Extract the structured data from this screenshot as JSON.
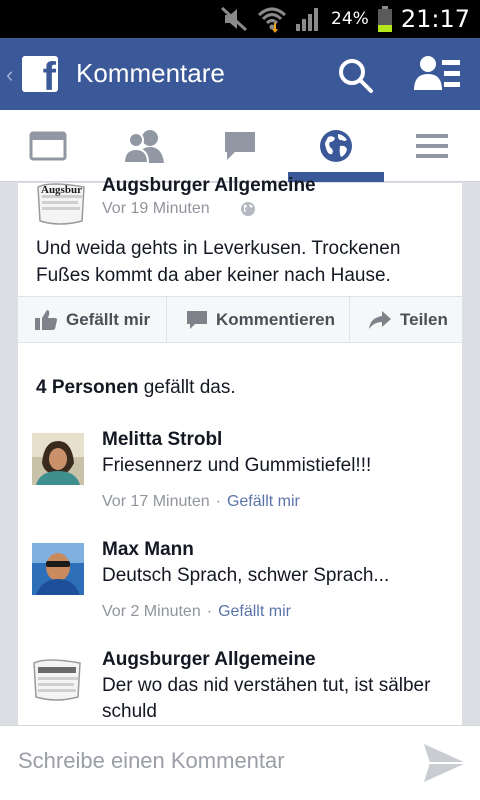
{
  "status_bar": {
    "battery_percent": "24%",
    "time": "21:17"
  },
  "app_bar": {
    "title": "Kommentare",
    "logo_letter": "f",
    "back": "‹"
  },
  "tabs": [
    {
      "id": "news-feed",
      "active": false
    },
    {
      "id": "friend-requests",
      "active": false
    },
    {
      "id": "messages",
      "active": false
    },
    {
      "id": "notifications",
      "active": true
    },
    {
      "id": "more",
      "active": false
    }
  ],
  "post": {
    "author": "Augsburger Allgemeine",
    "time": "Vor 19 Minuten",
    "text": "Und weida gehts in Leverkusen. Trockenen Fußes kommt da aber keiner nach Hause."
  },
  "actions": {
    "like": "Gefällt mir",
    "comment": "Kommentieren",
    "share": "Teilen"
  },
  "likes": {
    "count": "4 Personen",
    "suffix": " gefällt das."
  },
  "comments": [
    {
      "name": "Melitta Strobl",
      "text": "Friesennerz und Gummistiefel!!!",
      "time": "Vor 17 Minuten",
      "like": "Gefällt mir"
    },
    {
      "name": "Max Mann",
      "text": "Deutsch Sprach, schwer Sprach...",
      "time": "Vor 2 Minuten",
      "like": "Gefällt mir"
    },
    {
      "name": "Augsburger Allgemeine",
      "text": "Der wo das nid verstähen tut, ist sälber schuld"
    }
  ],
  "composer": {
    "placeholder": "Schreibe einen Kommentar"
  },
  "avatar_text": "Augsbur",
  "colors": {
    "brand": "#3b5998",
    "meta": "#90949c",
    "link": "#5b74a8"
  }
}
